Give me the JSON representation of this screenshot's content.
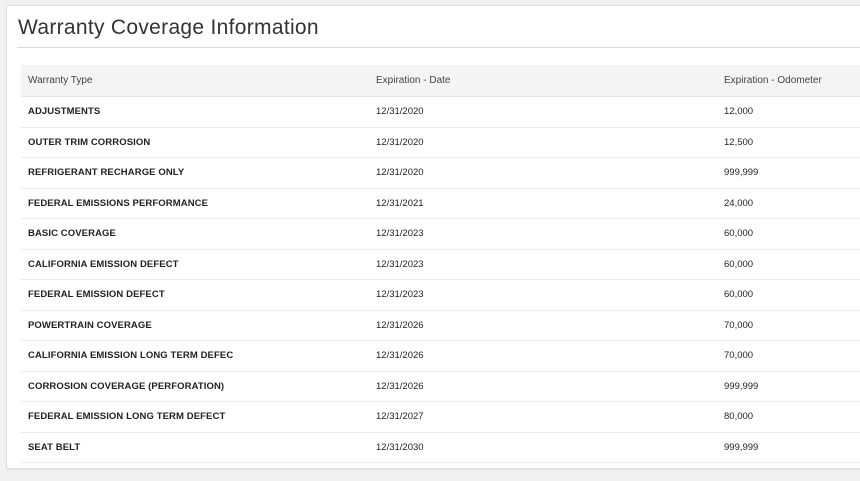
{
  "panel": {
    "title": "Warranty Coverage Information"
  },
  "table": {
    "headers": {
      "type": "Warranty Type",
      "date": "Expiration - Date",
      "odometer": "Expiration - Odometer"
    },
    "rows": [
      {
        "type": "ADJUSTMENTS",
        "date": "12/31/2020",
        "odometer": "12,000"
      },
      {
        "type": "OUTER TRIM CORROSION",
        "date": "12/31/2020",
        "odometer": "12,500"
      },
      {
        "type": "REFRIGERANT RECHARGE ONLY",
        "date": "12/31/2020",
        "odometer": "999,999"
      },
      {
        "type": "FEDERAL EMISSIONS PERFORMANCE",
        "date": "12/31/2021",
        "odometer": "24,000"
      },
      {
        "type": "BASIC COVERAGE",
        "date": "12/31/2023",
        "odometer": "60,000"
      },
      {
        "type": "CALIFORNIA EMISSION DEFECT",
        "date": "12/31/2023",
        "odometer": "60,000"
      },
      {
        "type": "FEDERAL EMISSION DEFECT",
        "date": "12/31/2023",
        "odometer": "60,000"
      },
      {
        "type": "POWERTRAIN COVERAGE",
        "date": "12/31/2026",
        "odometer": "70,000"
      },
      {
        "type": "CALIFORNIA EMISSION LONG TERM DEFEC",
        "date": "12/31/2026",
        "odometer": "70,000"
      },
      {
        "type": "CORROSION COVERAGE (PERFORATION)",
        "date": "12/31/2026",
        "odometer": "999,999"
      },
      {
        "type": "FEDERAL EMISSION LONG TERM DEFECT",
        "date": "12/31/2027",
        "odometer": "80,000"
      },
      {
        "type": "SEAT BELT",
        "date": "12/31/2030",
        "odometer": "999,999"
      }
    ]
  }
}
